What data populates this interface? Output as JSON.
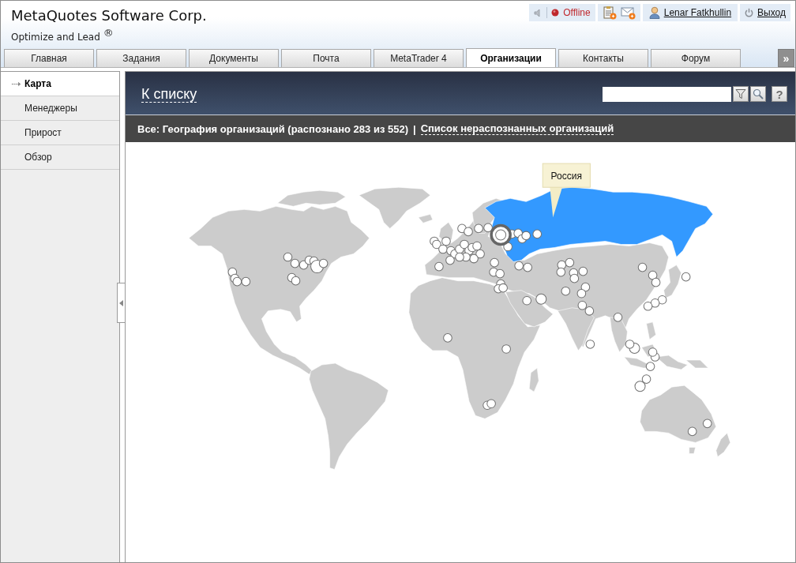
{
  "header": {
    "company": "MetaQuotes Software Corp.",
    "slogan": "Optimize and Lead $^{®}$"
  },
  "toolbar": {
    "status": {
      "label": "Offline",
      "online": false
    },
    "user": "Lenar Fatkhullin",
    "logout": "Выход"
  },
  "tabs": [
    {
      "label": "Главная",
      "selected": false
    },
    {
      "label": "Задания",
      "selected": false
    },
    {
      "label": "Документы",
      "selected": false
    },
    {
      "label": "Почта",
      "selected": false
    },
    {
      "label": "MetaTrader 4",
      "selected": false
    },
    {
      "label": "Организации",
      "selected": true
    },
    {
      "label": "Контакты",
      "selected": false
    },
    {
      "label": "Форум",
      "selected": false
    }
  ],
  "tabs_more": "»",
  "sidebar": {
    "items": [
      {
        "label": "Карта",
        "selected": true
      },
      {
        "label": "Менеджеры",
        "selected": false
      },
      {
        "label": "Прирост",
        "selected": false
      },
      {
        "label": "Обзор",
        "selected": false
      }
    ]
  },
  "panel": {
    "back_link": "К списку",
    "help_button": "?"
  },
  "summary": {
    "title": "Все: География организаций (распознано 283 из 552)",
    "separator": "|",
    "link": "Список нераспознанных организаций"
  },
  "map": {
    "tooltip": "Россия"
  }
}
